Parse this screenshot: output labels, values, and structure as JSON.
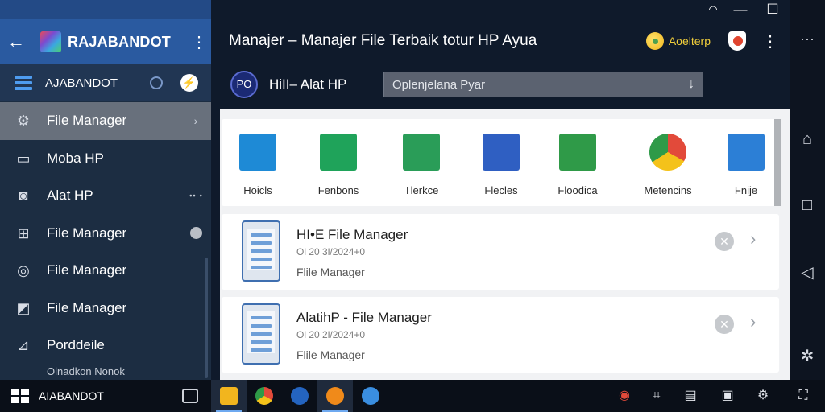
{
  "window": {
    "minimize": "—",
    "maximize": "☐",
    "close": "✕",
    "overflow": "···"
  },
  "sidebar": {
    "app_title": "RAJABANDOT",
    "account_name": "AJABANDOT",
    "items": [
      {
        "label": "File Manager",
        "icon": "gear-icon",
        "glyph": "⚙",
        "tail": "›",
        "active": true
      },
      {
        "label": "Moba HP",
        "icon": "folder-icon",
        "glyph": "▭",
        "tail": ""
      },
      {
        "label": "Alat HP",
        "icon": "camera-icon",
        "glyph": "◙",
        "tail": "ꞏꞏ ꞏ"
      },
      {
        "label": "File Manager",
        "icon": "grid-icon",
        "glyph": "⊞",
        "tail": ""
      },
      {
        "label": "File Manager",
        "icon": "clock-icon",
        "glyph": "◎",
        "tail": ""
      },
      {
        "label": "File Manager",
        "icon": "gallery-icon",
        "glyph": "◩",
        "tail": ""
      },
      {
        "label": "Porddeile",
        "icon": "image-icon",
        "glyph": "⊿",
        "tail": ""
      }
    ],
    "footer_text": "Olnadkon Nonok"
  },
  "main": {
    "title": "Manajer – Manajer File Terbaik totur HP Ayua",
    "accel_label": "Aoelterp",
    "avatar_text": "PO",
    "app_name": "HiII– Alat HP",
    "search_value": "Oplenjelana Pyar"
  },
  "categories": [
    {
      "label": "Hoicls",
      "icon": "pi-icon",
      "color": "#1e8ad6"
    },
    {
      "label": "Fenbons",
      "icon": "chart-icon",
      "color": "#1fa35a"
    },
    {
      "label": "Tlerkce",
      "icon": "doc-icon",
      "color": "#2a9d58"
    },
    {
      "label": "Flecles",
      "icon": "edit-icon",
      "color": "#2f5fc2"
    },
    {
      "label": "Floodica",
      "icon": "check-folder-icon",
      "color": "#2f9a48"
    },
    {
      "label": "Metencins",
      "icon": "chrome-icon",
      "color": "#e24a3a"
    },
    {
      "label": "Fnije",
      "icon": "docs-icon",
      "color": "#2c7fd6"
    }
  ],
  "files": [
    {
      "title": "HI•E File Manager",
      "date": "Ol 20 3l/2024+0",
      "subtitle": "Flile Manager"
    },
    {
      "title": "AlatihP - File Manager",
      "date": "Ol 20 2l/2024+0",
      "subtitle": "Flile Manager"
    }
  ],
  "taskbar": {
    "name": "AIABANDOT",
    "apps": [
      {
        "name": "file-explorer-icon",
        "color": "#f2b51e",
        "active": true
      },
      {
        "name": "chrome-icon",
        "color": "#e24a3a",
        "active": false
      },
      {
        "name": "store-icon",
        "color": "#2464c0",
        "active": false
      },
      {
        "name": "orange-app-icon",
        "color": "#f08a1a",
        "active": true
      },
      {
        "name": "sync-icon",
        "color": "#3a8ee0",
        "active": false
      }
    ]
  }
}
